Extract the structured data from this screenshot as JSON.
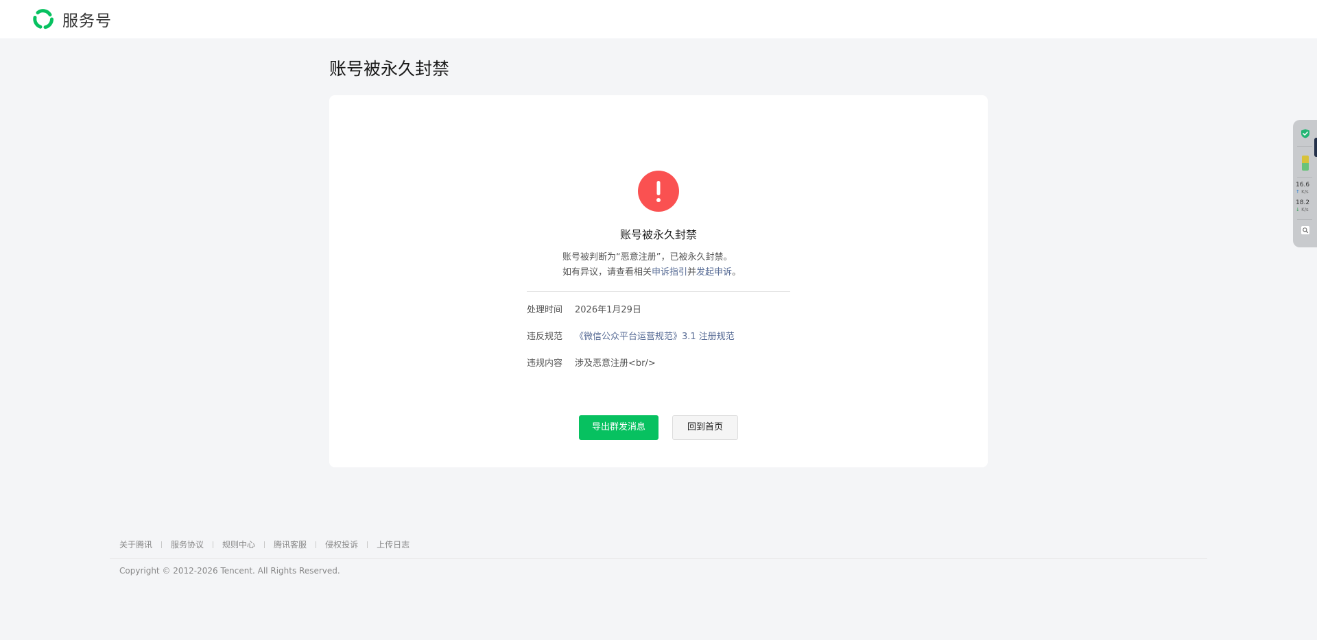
{
  "header": {
    "brand_name": "服务号",
    "brand_color": "#07c160"
  },
  "page": {
    "title": "账号被永久封禁"
  },
  "card": {
    "icon": "exclamation-circle-icon",
    "icon_color": "#fa5151",
    "heading": "账号被永久封禁",
    "desc_line1": "账号被判断为“恶意注册”，已被永久封禁。",
    "desc_line2_prefix": "如有异议，请查看相关",
    "desc_link_guide": "申诉指引",
    "desc_line2_mid": "并",
    "desc_link_appeal": "发起申诉",
    "desc_line2_suffix": "。",
    "link_color": "#576b95",
    "details": [
      {
        "label": "处理时间",
        "value": "2026年1月29日"
      },
      {
        "label": "违反规范",
        "value": "《微信公众平台运营规范》3.1 注册规范"
      },
      {
        "label": "违规内容",
        "value": "涉及恶意注册<br/>"
      }
    ],
    "buttons": {
      "export_label": "导出群发消息",
      "home_label": "回到首页"
    }
  },
  "footer": {
    "links": [
      "关于腾讯",
      "服务协议",
      "规则中心",
      "腾讯客服",
      "侵权投诉",
      "上传日志"
    ],
    "copyright": "Copyright © 2012-2026 Tencent. All Rights Reserved."
  },
  "float_widget": {
    "shield_icon": "shield-check-icon",
    "upload_speed": "16.6",
    "upload_unit": "K/s",
    "download_speed": "18.2",
    "download_unit": "K/s",
    "search_icon": "search-icon"
  }
}
